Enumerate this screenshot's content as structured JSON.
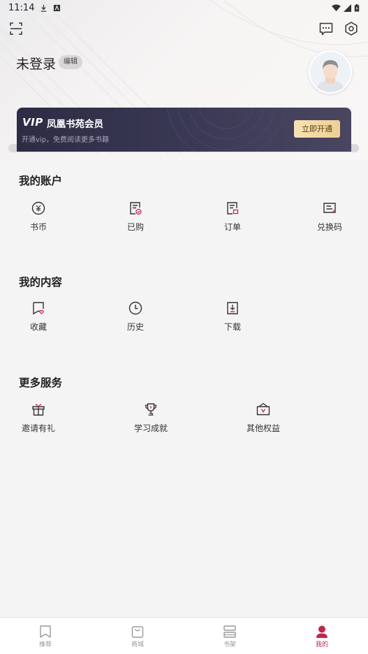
{
  "status_bar": {
    "time": "11:14"
  },
  "user": {
    "name": "未登录",
    "edit_label": "编辑"
  },
  "vip": {
    "logo": "VIP",
    "title": "凤凰书苑会员",
    "subtitle": "开通vip，免费阅读更多书籍",
    "button": "立即开通"
  },
  "account": {
    "title": "我的账户",
    "items": [
      {
        "label": "书币",
        "icon": "coin-icon"
      },
      {
        "label": "已购",
        "icon": "purchased-icon"
      },
      {
        "label": "订单",
        "icon": "order-icon"
      },
      {
        "label": "兑换码",
        "icon": "redeem-code-icon"
      }
    ]
  },
  "content": {
    "title": "我的内容",
    "items": [
      {
        "label": "收藏",
        "icon": "favorite-icon"
      },
      {
        "label": "历史",
        "icon": "history-icon"
      },
      {
        "label": "下载",
        "icon": "download-icon"
      }
    ]
  },
  "services": {
    "title": "更多服务",
    "items": [
      {
        "label": "邀请有礼",
        "icon": "gift-icon"
      },
      {
        "label": "学习成就",
        "icon": "trophy-icon"
      },
      {
        "label": "其他权益",
        "icon": "benefits-icon"
      }
    ]
  },
  "bottom_nav": {
    "items": [
      {
        "label": "推荐",
        "icon": "bookmark-icon"
      },
      {
        "label": "商城",
        "icon": "shop-bag-icon"
      },
      {
        "label": "书架",
        "icon": "bookshelf-icon"
      },
      {
        "label": "我的",
        "icon": "profile-icon",
        "active": true
      }
    ]
  },
  "colors": {
    "accent": "#c0274c",
    "vip_card": "#2d2c44",
    "vip_button": "#f3d9a5"
  }
}
